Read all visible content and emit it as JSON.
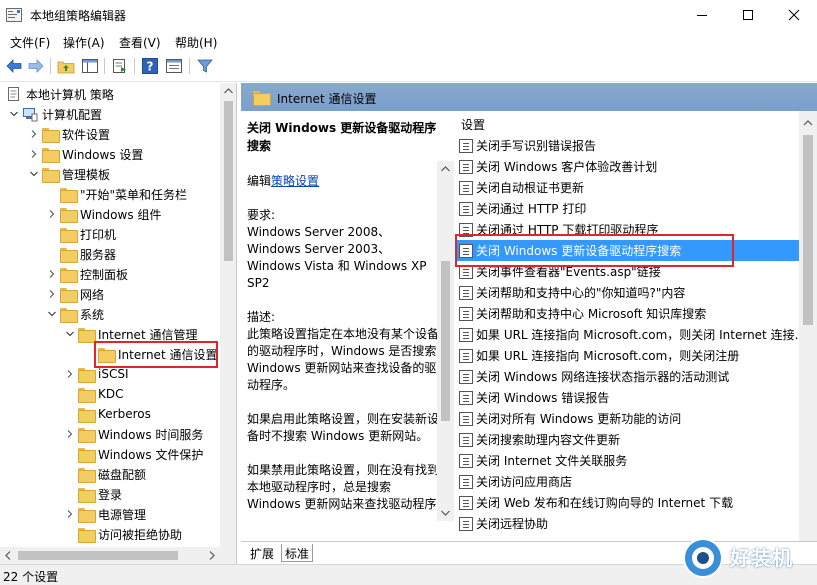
{
  "window": {
    "title": "本地组策略编辑器",
    "controls": {
      "minimize": "minimize-icon",
      "maximize": "maximize-icon",
      "close": "close-icon"
    }
  },
  "menubar": {
    "items": [
      "文件(F)",
      "操作(A)",
      "查看(V)",
      "帮助(H)"
    ]
  },
  "toolbar": {
    "icons": [
      "back-arrow-icon",
      "forward-arrow-icon",
      "up-folder-icon",
      "show-hide-tree-icon",
      "export-list-icon",
      "help-icon",
      "properties-icon",
      "filter-icon"
    ]
  },
  "tree": {
    "nodes": [
      {
        "label": "本地计算机 策略",
        "level": 0,
        "expander": "none",
        "icon": "policy-computer-icon"
      },
      {
        "label": "计算机配置",
        "level": 1,
        "expander": "expanded",
        "icon": "computer-config-icon"
      },
      {
        "label": "软件设置",
        "level": 2,
        "expander": "collapsed",
        "icon": "folder-icon"
      },
      {
        "label": "Windows 设置",
        "level": 2,
        "expander": "collapsed",
        "icon": "folder-icon"
      },
      {
        "label": "管理模板",
        "level": 2,
        "expander": "expanded",
        "icon": "folder-icon"
      },
      {
        "label": "\"开始\"菜单和任务栏",
        "level": 3,
        "expander": "none",
        "icon": "folder-icon"
      },
      {
        "label": "Windows 组件",
        "level": 3,
        "expander": "collapsed",
        "icon": "folder-icon"
      },
      {
        "label": "打印机",
        "level": 3,
        "expander": "none",
        "icon": "folder-icon"
      },
      {
        "label": "服务器",
        "level": 3,
        "expander": "none",
        "icon": "folder-icon"
      },
      {
        "label": "控制面板",
        "level": 3,
        "expander": "collapsed",
        "icon": "folder-icon"
      },
      {
        "label": "网络",
        "level": 3,
        "expander": "collapsed",
        "icon": "folder-icon"
      },
      {
        "label": "系统",
        "level": 3,
        "expander": "expanded",
        "icon": "folder-icon"
      },
      {
        "label": "Internet 通信管理",
        "level": 4,
        "expander": "expanded",
        "icon": "folder-icon"
      },
      {
        "label": "Internet 通信设置",
        "level": 5,
        "expander": "none",
        "icon": "folder-icon",
        "highlighted": true
      },
      {
        "label": "iSCSI",
        "level": 4,
        "expander": "collapsed",
        "icon": "folder-icon"
      },
      {
        "label": "KDC",
        "level": 4,
        "expander": "none",
        "icon": "folder-icon"
      },
      {
        "label": "Kerberos",
        "level": 4,
        "expander": "none",
        "icon": "folder-icon"
      },
      {
        "label": "Windows 时间服务",
        "level": 4,
        "expander": "collapsed",
        "icon": "folder-icon"
      },
      {
        "label": "Windows 文件保护",
        "level": 4,
        "expander": "none",
        "icon": "folder-icon"
      },
      {
        "label": "磁盘配额",
        "level": 4,
        "expander": "none",
        "icon": "folder-icon"
      },
      {
        "label": "登录",
        "level": 4,
        "expander": "none",
        "icon": "folder-icon"
      },
      {
        "label": "电源管理",
        "level": 4,
        "expander": "collapsed",
        "icon": "folder-icon"
      },
      {
        "label": "访问被拒绝协助",
        "level": 4,
        "expander": "none",
        "icon": "folder-icon"
      }
    ]
  },
  "details": {
    "header": "Internet 通信设置",
    "description": {
      "title": "关闭 Windows 更新设备驱动程序搜索",
      "edit_prefix": "编辑",
      "edit_link": "策略设置",
      "requirements_label": "要求:",
      "requirements_text": "Windows Server 2008、Windows Server 2003、Windows Vista 和 Windows XP SP2",
      "desc_label": "描述:",
      "desc_text": "此策略设置指定在本地没有某个设备的驱动程序时，Windows 是否搜索 Windows 更新网站来查找设备的驱动程序。",
      "enabled_text": "如果启用此策略设置，则在安装新设备时不搜索 Windows 更新网站。",
      "disabled_text": "如果禁用此策略设置，则在没有找到本地驱动程序时，总是搜索 Windows 更新网站来查找驱动程序"
    },
    "list": {
      "column_header": "设置",
      "items": [
        "关闭手写识别错误报告",
        "关闭 Windows 客户体验改善计划",
        "关闭自动根证书更新",
        "关闭通过 HTTP 打印",
        "关闭通过 HTTP 下载打印驱动程序",
        "关闭 Windows 更新设备驱动程序搜索",
        "关闭事件查看器\"Events.asp\"链接",
        "关闭帮助和支持中心的\"你知道吗?\"内容",
        "关闭帮助和支持中心 Microsoft 知识库搜索",
        "如果 URL 连接指向 Microsoft.com，则关闭 Internet 连接...",
        "如果 URL 连接指向 Microsoft.com，则关闭注册",
        "关闭 Windows 网络连接状态指示器的活动测试",
        "关闭 Windows 错误报告",
        "关闭对所有 Windows 更新功能的访问",
        "关闭搜索助理内容文件更新",
        "关闭 Internet 文件关联服务",
        "关闭访问应用商店",
        "关闭 Web 发布和在线订购向导的 Internet 下载",
        "关闭远程协助"
      ],
      "selected_index": 5
    },
    "tabs": [
      "扩展",
      "标准"
    ],
    "active_tab": 1
  },
  "status": {
    "text": "22 个设置"
  },
  "watermark": {
    "text": "好装机"
  },
  "colors": {
    "selection": "#3399ff",
    "highlight_box": "#e0262c",
    "header_bar": "#7b9fcb",
    "link": "#0645ad"
  }
}
